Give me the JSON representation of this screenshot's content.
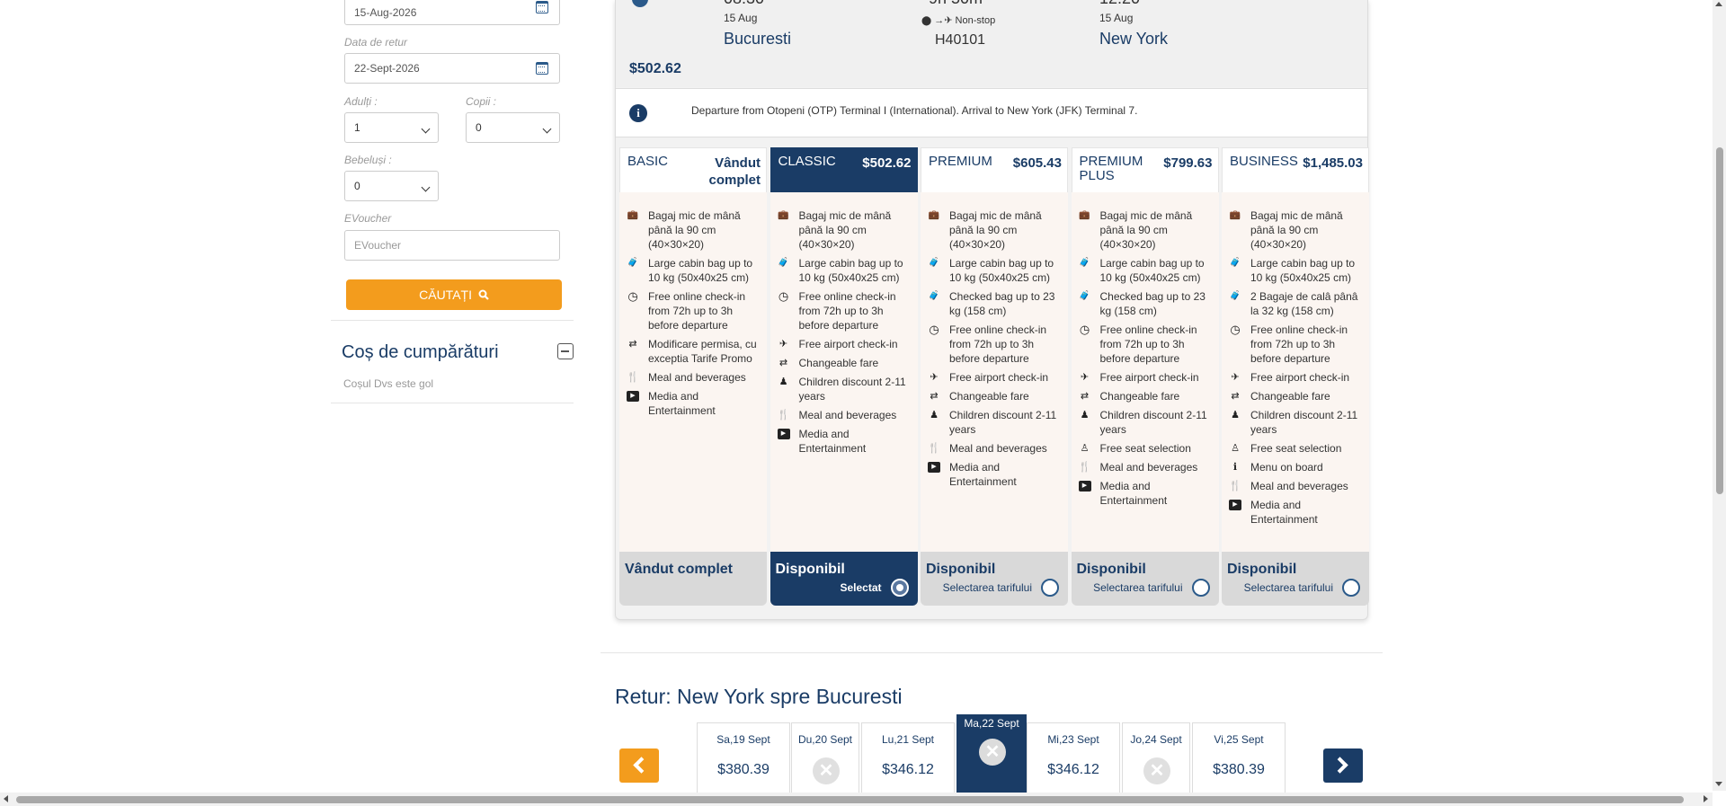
{
  "search_form": {
    "depart_date": "15-Aug-2026",
    "return_label": "Data de retur",
    "return_date": "22-Sept-2026",
    "adults_label": "Adulți :",
    "adults_value": "1",
    "children_label": "Copii :",
    "children_value": "0",
    "infants_label": "Bebeluși :",
    "infants_value": "0",
    "evoucher_label": "EVoucher",
    "evoucher_placeholder": "EVoucher",
    "search_button": "CĂUTAȚI"
  },
  "cart": {
    "title": "Coș de cumpărături",
    "empty_text": "Coșul Dvs este gol"
  },
  "flight": {
    "dep_time_partial": "08:30",
    "dep_date": "15 Aug",
    "dep_city": "Bucuresti",
    "duration_partial": "9h 50m",
    "stops": "Non-stop",
    "flight_number": "H40101",
    "arr_time_partial": "12:20",
    "arr_date": "15 Aug",
    "arr_city": "New York",
    "price": "$502.62",
    "info": "Departure from Otopeni (OTP) Terminal I (International). Arrival to New York (JFK) Terminal 7."
  },
  "fares": [
    {
      "name": "BASIC",
      "price": "Vândut complet",
      "status": "Vândut complet",
      "select_label": "",
      "features": [
        {
          "icon": "briefcase-icon",
          "text": "Bagaj mic de mână până la 90 cm (40×30×20)"
        },
        {
          "icon": "suitcase-icon",
          "text": "Large cabin bag up to 10 kg (50x40x25 cm)"
        },
        {
          "icon": "clock-icon",
          "text": "Free online check-in from 72h up to 3h before departure"
        },
        {
          "icon": "exchange-icon",
          "text": "Modificare permisa, cu exceptia Tarife Promo"
        },
        {
          "icon": "cutlery-icon",
          "text": "Meal and beverages"
        },
        {
          "icon": "media-icon",
          "text": "Media and Entertainment"
        }
      ]
    },
    {
      "name": "CLASSIC",
      "price": "$502.62",
      "status": "Disponibil",
      "select_label": "Selectat",
      "features": [
        {
          "icon": "briefcase-icon",
          "text": "Bagaj mic de mână până la 90 cm (40×30×20)"
        },
        {
          "icon": "suitcase-icon",
          "text": "Large cabin bag up to 10 kg (50x40x25 cm)"
        },
        {
          "icon": "clock-icon",
          "text": "Free online check-in from 72h up to 3h before departure"
        },
        {
          "icon": "plane-icon",
          "text": "Free airport check-in"
        },
        {
          "icon": "exchange-icon",
          "text": "Changeable fare"
        },
        {
          "icon": "child-icon",
          "text": "Children discount 2-11 years"
        },
        {
          "icon": "cutlery-icon",
          "text": "Meal and beverages"
        },
        {
          "icon": "media-icon",
          "text": "Media and Entertainment"
        }
      ]
    },
    {
      "name": "PREMIUM",
      "price": "$605.43",
      "status": "Disponibil",
      "select_label": "Selectarea tarifului",
      "features": [
        {
          "icon": "briefcase-icon",
          "text": "Bagaj mic de mână până la 90 cm (40×30×20)"
        },
        {
          "icon": "suitcase-icon",
          "text": "Large cabin bag up to 10 kg (50x40x25 cm)"
        },
        {
          "icon": "suitcase-icon",
          "text": "Checked bag up to 23 kg (158 cm)"
        },
        {
          "icon": "clock-icon",
          "text": "Free online check-in from 72h up to 3h before departure"
        },
        {
          "icon": "plane-icon",
          "text": "Free airport check-in"
        },
        {
          "icon": "exchange-icon",
          "text": "Changeable fare"
        },
        {
          "icon": "child-icon",
          "text": "Children discount 2-11 years"
        },
        {
          "icon": "cutlery-icon",
          "text": "Meal and beverages"
        },
        {
          "icon": "media-icon",
          "text": "Media and Entertainment"
        }
      ]
    },
    {
      "name": "PREMIUM PLUS",
      "price": "$799.63",
      "status": "Disponibil",
      "select_label": "Selectarea tarifului",
      "features": [
        {
          "icon": "briefcase-icon",
          "text": "Bagaj mic de mână până la 90 cm (40×30×20)"
        },
        {
          "icon": "suitcase-icon",
          "text": "Large cabin bag up to 10 kg (50x40x25 cm)"
        },
        {
          "icon": "suitcase-icon",
          "text": "Checked bag up to 23 kg (158 cm)"
        },
        {
          "icon": "clock-icon",
          "text": "Free online check-in from 72h up to 3h before departure"
        },
        {
          "icon": "plane-icon",
          "text": "Free airport check-in"
        },
        {
          "icon": "exchange-icon",
          "text": "Changeable fare"
        },
        {
          "icon": "child-icon",
          "text": "Children discount 2-11 years"
        },
        {
          "icon": "seat-icon",
          "text": "Free seat selection"
        },
        {
          "icon": "cutlery-icon",
          "text": "Meal and beverages"
        },
        {
          "icon": "media-icon",
          "text": "Media and Entertainment"
        }
      ]
    },
    {
      "name": "BUSINESS",
      "price": "$1,485.03",
      "status": "Disponibil",
      "select_label": "Selectarea tarifului",
      "features": [
        {
          "icon": "briefcase-icon",
          "text": "Bagaj mic de mână până la 90 cm (40×30×20)"
        },
        {
          "icon": "suitcase-icon",
          "text": "Large cabin bag up to 10 kg (50x40x25 cm)"
        },
        {
          "icon": "suitcase-icon",
          "text": "2 Bagaje de calâ pânâ la 32 kg (158 cm)"
        },
        {
          "icon": "clock-icon",
          "text": "Free online check-in from 72h up to 3h before departure"
        },
        {
          "icon": "plane-icon",
          "text": "Free airport check-in"
        },
        {
          "icon": "exchange-icon",
          "text": "Changeable fare"
        },
        {
          "icon": "child-icon",
          "text": "Children discount 2-11 years"
        },
        {
          "icon": "seat-icon",
          "text": "Free seat selection"
        },
        {
          "icon": "menu-icon",
          "text": "Menu on board"
        },
        {
          "icon": "cutlery-icon",
          "text": "Meal and beverages"
        },
        {
          "icon": "media-icon",
          "text": "Media and Entertainment"
        }
      ]
    }
  ],
  "return_section": {
    "title": "Retur: New York spre Bucuresti",
    "dates": [
      {
        "label": "Sa,19 Sept",
        "price": "$380.39",
        "available": true,
        "active": false
      },
      {
        "label": "Du,20 Sept",
        "price": "",
        "available": false,
        "active": false
      },
      {
        "label": "Lu,21 Sept",
        "price": "$346.12",
        "available": true,
        "active": false
      },
      {
        "label": "Ma,22 Sept",
        "price": "",
        "available": false,
        "active": true
      },
      {
        "label": "Mi,23 Sept",
        "price": "$346.12",
        "available": true,
        "active": false
      },
      {
        "label": "Jo,24 Sept",
        "price": "",
        "available": false,
        "active": false
      },
      {
        "label": "Vi,25 Sept",
        "price": "$380.39",
        "available": true,
        "active": false
      }
    ]
  },
  "colors": {
    "navy": "#1a3c66",
    "orange": "#f39c1d",
    "fare_body": "#fbf5f1"
  }
}
